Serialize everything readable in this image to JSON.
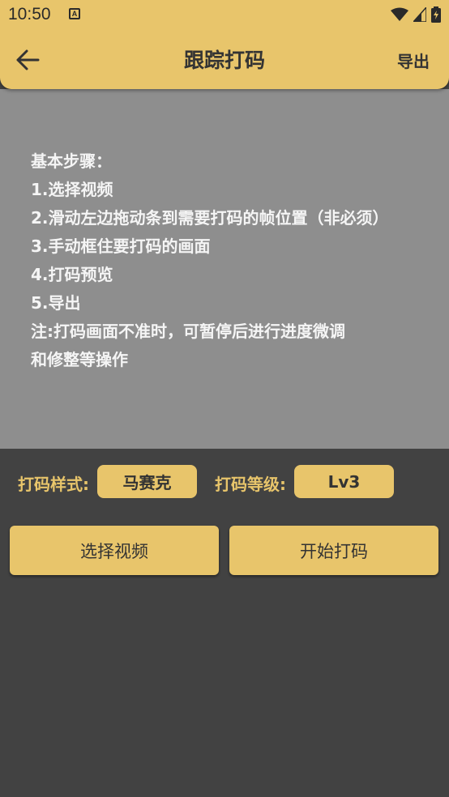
{
  "colors": {
    "accent": "#e8c56b",
    "panel": "#8e8e8e",
    "background": "#424242"
  },
  "status_bar": {
    "time": "10:50",
    "notification_icon": "A"
  },
  "header": {
    "back_icon": "arrow-left-icon",
    "title": "跟踪打码",
    "export_label": "导出"
  },
  "instructions": {
    "lines": [
      "基本步骤：",
      "1.选择视频",
      "2.滑动左边拖动条到需要打码的帧位置（非必须）",
      "3.手动框住要打码的画面",
      "4.打码预览",
      "5.导出",
      "注:打码画面不准时，可暂停后进行进度微调",
      "和修整等操作"
    ]
  },
  "settings": {
    "style_label": "打码样式:",
    "style_value": "马赛克",
    "level_label": "打码等级:",
    "level_value": "Lv3"
  },
  "actions": {
    "select_video": "选择视频",
    "start_mosaic": "开始打码"
  }
}
